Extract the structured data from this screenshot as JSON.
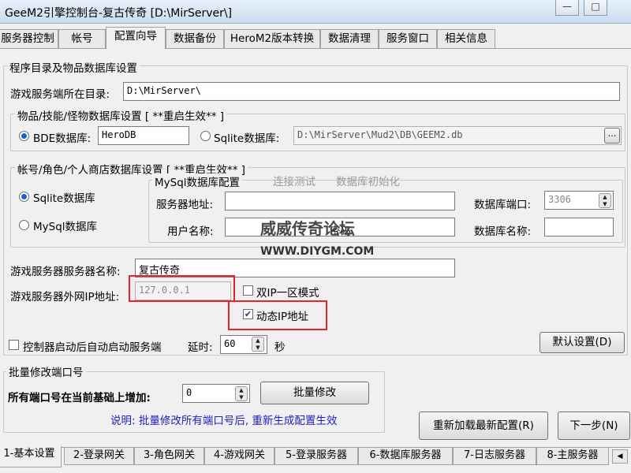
{
  "window": {
    "title": "GeeM2引擎控制台-复古传奇 [D:\\MirServer\\]",
    "minimize": "—",
    "maximize": "□"
  },
  "tabs": [
    {
      "label": "服务器控制"
    },
    {
      "label": "帐号"
    },
    {
      "label": "配置向导"
    },
    {
      "label": "数据备份"
    },
    {
      "label": "HeroM2版本转换"
    },
    {
      "label": "数据清理"
    },
    {
      "label": "服务窗口"
    },
    {
      "label": "相关信息"
    }
  ],
  "main": {
    "group_title": "程序目录及物品数据库设置",
    "server_dir_label": "游戏服务端所在目录:",
    "server_dir_value": "D:\\MirServer\\",
    "item_db": {
      "title": "物品/技能/怪物数据库设置 [ **重启生效** ]",
      "bde_label": "BDE数据库:",
      "bde_value": "HeroDB",
      "sqlite_label": "Sqlite数据库:",
      "sqlite_value": "D:\\MirServer\\Mud2\\DB\\GEEM2.db",
      "browse": "..."
    },
    "account_db": {
      "title": "帐号/角色/个人商店数据库设置 [ **重启生效** ]",
      "sqlite_label": "Sqlite数据库",
      "mysql_label": "MySql数据库",
      "mysql_config_title": "MySql数据库配置",
      "test_connection": "连接测试",
      "db_init": "数据库初始化",
      "server_addr_label": "服务器地址:",
      "server_addr_value": "",
      "db_port_label": "数据库端口:",
      "db_port_value": "3306",
      "username_label": "用户名称:",
      "username_value": "",
      "password_label": "密码",
      "password_value": "",
      "db_name_label": "数据库名称:",
      "db_name_value": ""
    },
    "server_name_label": "游戏服务器服务器名称:",
    "server_name_value": "复古传奇",
    "external_ip_label": "游戏服务器外网IP地址:",
    "external_ip_value": "127.0.0.1",
    "dual_ip_label": "双IP一区模式",
    "dynamic_ip_label": "动态IP地址",
    "auto_start_label": "控制器启动后自动启动服务端",
    "delay_label": "延时:",
    "delay_value": "60",
    "seconds_label": "秒",
    "default_button": "默认设置(D)"
  },
  "watermark": {
    "line1": "威威传奇论坛",
    "line2": "WWW.DIYGM.COM"
  },
  "batch": {
    "title": "批量修改端口号",
    "increase_label": "所有端口号在当前基础上增加:",
    "increase_value": "0",
    "modify_button": "批量修改",
    "note": "说明: 批量修改所有端口号后, 重新生成配置生效"
  },
  "actions": {
    "reload": "重新加载最新配置(R)",
    "next": "下一步(N)"
  },
  "bottom_tabs": [
    {
      "label": "1-基本设置"
    },
    {
      "label": "2-登录网关"
    },
    {
      "label": "3-角色网关"
    },
    {
      "label": "4-游戏网关"
    },
    {
      "label": "5-登录服务器"
    },
    {
      "label": "6-数据库服务器"
    },
    {
      "label": "7-日志服务器"
    },
    {
      "label": "8-主服务器"
    }
  ],
  "colors": {
    "highlight_box": "#e8232e",
    "note_text": "#2020c0",
    "radio_dot": "#1a5fd0"
  }
}
